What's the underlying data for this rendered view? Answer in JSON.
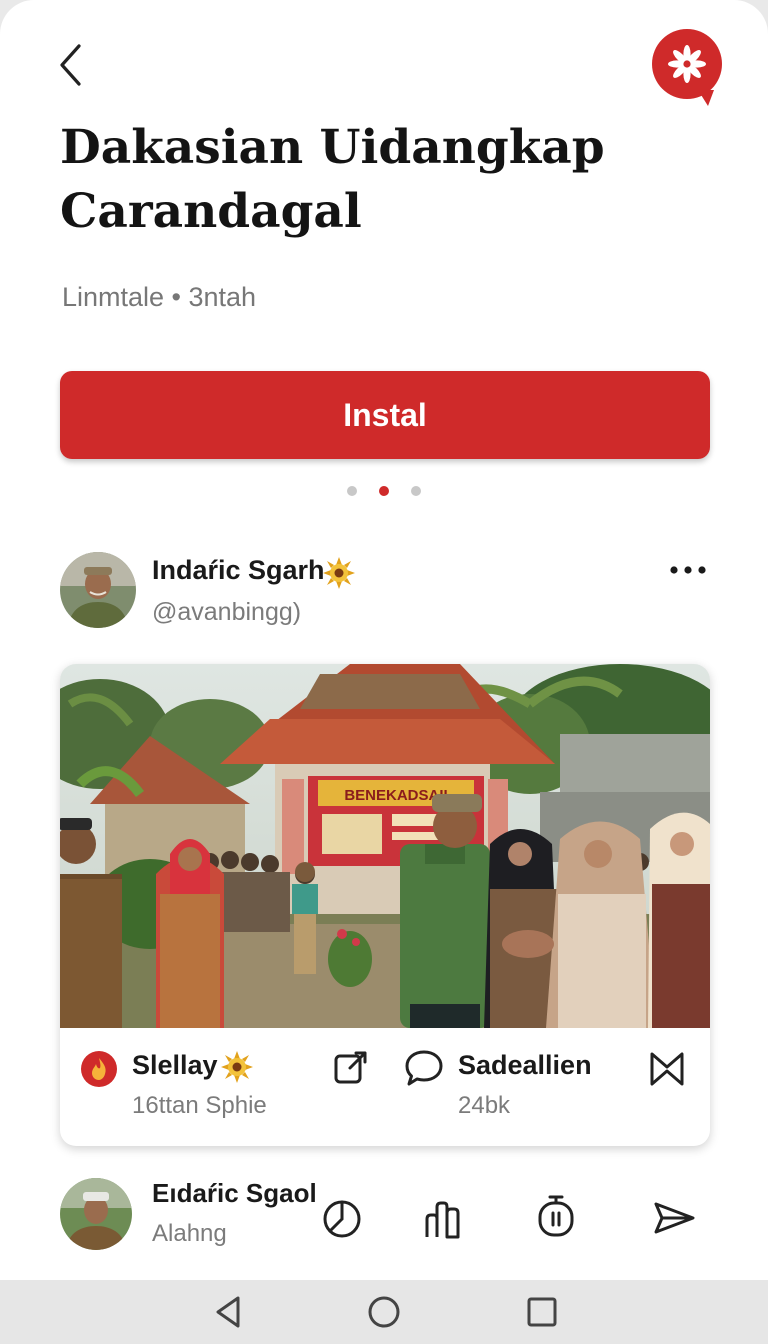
{
  "header": {
    "back_icon": "chevron-left-icon",
    "app_badge_icon": "flower-chat-icon",
    "title": "Dakasian Uidangkap Carandagal",
    "meta": "Linmtale • 3ntah"
  },
  "install": {
    "label": "Instal"
  },
  "pager": {
    "count": 3,
    "active_index": 1
  },
  "post": {
    "author_name": "Indaŕic Sgarh",
    "author_handle": "@avanbingg)",
    "verified_icon": "sun-badge-icon",
    "more_icon": "more-horizontal-icon",
    "banner_text": "BENEKADSAII",
    "footer": {
      "left_name": "Slellay",
      "left_sub": "16ttan Sphie",
      "right_name": "Sadeallien",
      "right_sub": "24bk",
      "icons": [
        "flame-icon",
        "sun-badge-icon",
        "external-link-icon",
        "chat-bubble-icon",
        "bookmark-icon"
      ]
    }
  },
  "comment": {
    "author_name": "Eıdaŕic Sgaol",
    "subtitle": "Alahng",
    "actions": [
      "pie-chart-icon",
      "bar-chart-icon",
      "timer-icon",
      "send-icon"
    ]
  },
  "navbar": {
    "icons": [
      "back-triangle-icon",
      "home-circle-icon",
      "recents-square-icon"
    ]
  },
  "colors": {
    "accent": "#cf2a2a",
    "text": "#1a1a1a",
    "muted": "#777777"
  }
}
